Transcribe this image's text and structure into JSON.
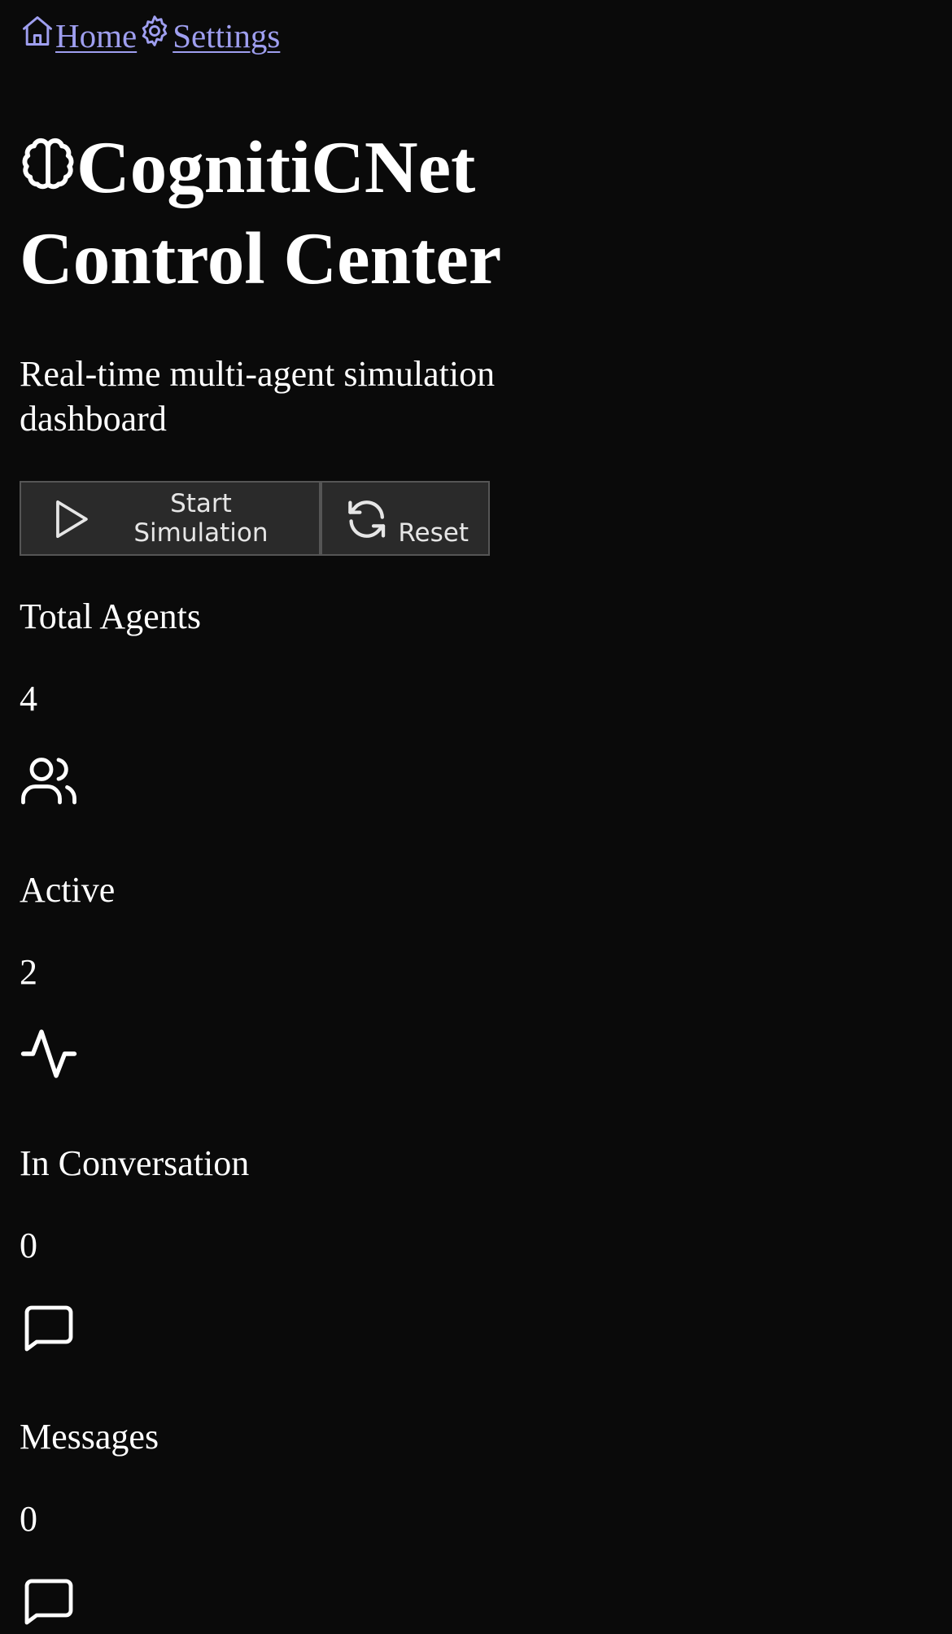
{
  "nav": {
    "home_label": "Home",
    "home_icon": "home-icon",
    "settings_label": "Settings",
    "settings_icon": "gear-icon",
    "link_color": "#9f9ff0"
  },
  "header": {
    "title_line1": "CognitiCNet",
    "title_line2": "Control Center",
    "title_icon": "brain-icon",
    "subtitle": "Real-time multi-agent simulation dashboard"
  },
  "actions": {
    "start_label": "Start Simulation",
    "start_icon": "play-icon",
    "reset_label": "Reset",
    "reset_icon": "refresh-icon"
  },
  "stats": [
    {
      "label": "Total Agents",
      "value": "4",
      "icon": "users-icon"
    },
    {
      "label": "Active",
      "value": "2",
      "icon": "activity-icon"
    },
    {
      "label": "In Conversation",
      "value": "0",
      "icon": "message-square-icon"
    },
    {
      "label": "Messages",
      "value": "0",
      "icon": "message-square-icon"
    }
  ],
  "colors": {
    "background": "#0a0a0a",
    "text": "#ffffff",
    "button_bg": "#2a2a2a",
    "button_border": "#555555"
  }
}
